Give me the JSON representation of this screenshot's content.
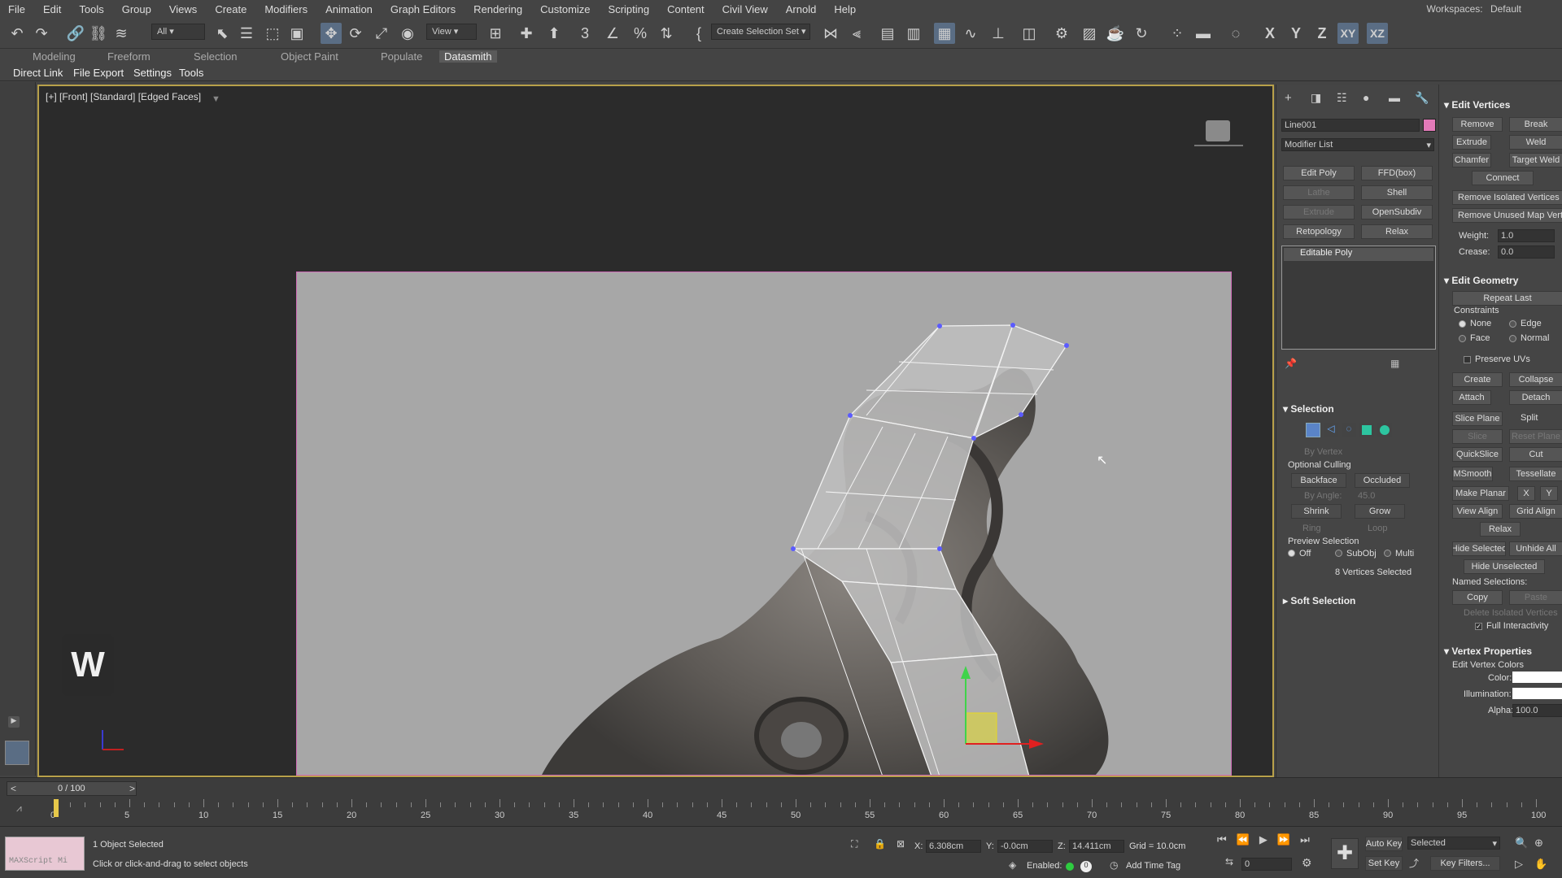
{
  "menu": [
    "File",
    "Edit",
    "Tools",
    "Group",
    "Views",
    "Create",
    "Modifiers",
    "Animation",
    "Graph Editors",
    "Rendering",
    "Customize",
    "Scripting",
    "Content",
    "Civil View",
    "Arnold",
    "Help"
  ],
  "workspaces": {
    "label": "Workspaces:",
    "value": "Default"
  },
  "toolbar": {
    "filter": "All",
    "ref_coord": "View",
    "named_sel": "Create Selection Set",
    "axis_x": "X",
    "axis_y": "Y",
    "axis_z": "Z",
    "axis_xy": "XY",
    "axis_xz": "XZ"
  },
  "ribbon_tabs": [
    "Modeling",
    "Freeform",
    "Selection",
    "Object Paint",
    "Populate",
    "Datasmith"
  ],
  "ribbon_selected": "Datasmith",
  "sub_tabs": [
    "Direct Link",
    "File Export",
    "Settings",
    "Tools"
  ],
  "viewport": {
    "label": "[+] [Front] [Standard] [Edged Faces]",
    "badge": "W"
  },
  "command_panel": {
    "object_name": "Line001",
    "object_color": "#e27ab8",
    "modifier_list": "Modifier List",
    "modifier_buttons": [
      [
        "Edit Poly",
        "FFD(box)"
      ],
      [
        "Lathe",
        "Shell"
      ],
      [
        "Extrude",
        "OpenSubdiv"
      ],
      [
        "Retopology",
        "Relax"
      ]
    ],
    "stack_item": "Editable Poly",
    "selection": {
      "title": "Selection",
      "by_vertex": "By Vertex",
      "optional_culling": "Optional Culling",
      "backface": "Backface",
      "occluded": "Occluded",
      "by_angle": "By Angle:",
      "by_angle_value": "45.0",
      "shrink": "Shrink",
      "grow": "Grow",
      "ring": "Ring",
      "loop": "Loop",
      "preview_selection": "Preview Selection",
      "off": "Off",
      "subobj": "SubObj",
      "multi": "Multi",
      "count": "8 Vertices Selected"
    },
    "soft_selection": "Soft Selection"
  },
  "right_panel": {
    "edit_vertices": "Edit Vertices",
    "remove": "Remove",
    "break": "Break",
    "extrude": "Extrude",
    "weld": "Weld",
    "chamfer": "Chamfer",
    "target_weld": "Target Weld",
    "connect": "Connect",
    "remove_isolated": "Remove Isolated Vertices",
    "remove_unused": "Remove Unused Map Verts",
    "weight_label": "Weight:",
    "weight": "1.0",
    "crease_label": "Crease:",
    "crease": "0.0",
    "edit_geometry": "Edit Geometry",
    "repeat_last": "Repeat Last",
    "constraints": "Constraints",
    "none": "None",
    "edge": "Edge",
    "face": "Face",
    "normal": "Normal",
    "preserve_uvs": "Preserve UVs",
    "create": "Create",
    "collapse": "Collapse",
    "attach": "Attach",
    "detach": "Detach",
    "slice_plane": "Slice Plane",
    "split": "Split",
    "slice": "Slice",
    "reset_plane": "Reset Plane",
    "quickslice": "QuickSlice",
    "cut": "Cut",
    "msmooth": "MSmooth",
    "tessellate": "Tessellate",
    "make_planar": "Make Planar",
    "x": "X",
    "y": "Y",
    "view_align": "View Align",
    "grid_align": "Grid Align",
    "relax": "Relax",
    "hide_selected": "Hide Selected",
    "unhide_all": "Unhide All",
    "hide_unselected": "Hide Unselected",
    "named_selections": "Named Selections:",
    "copy": "Copy",
    "paste": "Paste",
    "delete_isolated": "Delete Isolated Vertices",
    "full_interactivity": "Full Interactivity",
    "vertex_properties": "Vertex Properties",
    "edit_vertex_colors": "Edit Vertex Colors",
    "color": "Color:",
    "illumination": "Illumination:",
    "alpha": "Alpha:",
    "alpha_value": "100.0"
  },
  "timeline": {
    "frame": "0 / 100",
    "ticks": [
      "0",
      "5",
      "10",
      "15",
      "20",
      "25",
      "30",
      "35",
      "40",
      "45",
      "50",
      "55",
      "60",
      "65",
      "70",
      "75",
      "80",
      "85",
      "90",
      "95",
      "100"
    ]
  },
  "status": {
    "maxscript": "MAXScript Mi",
    "selected_msg": "1 Object Selected",
    "hint": "Click or click-and-drag to select objects",
    "x_label": "X:",
    "x": "6.308cm",
    "y_label": "Y:",
    "y": "-0.0cm",
    "z_label": "Z:",
    "z": "14.411cm",
    "grid": "Grid = 10.0cm",
    "enabled": "Enabled:",
    "add_time_tag": "Add Time Tag",
    "auto_key": "Auto Key",
    "selected_dd": "Selected",
    "set_key": "Set Key",
    "key_filters": "Key Filters...",
    "frame_field": "0"
  }
}
